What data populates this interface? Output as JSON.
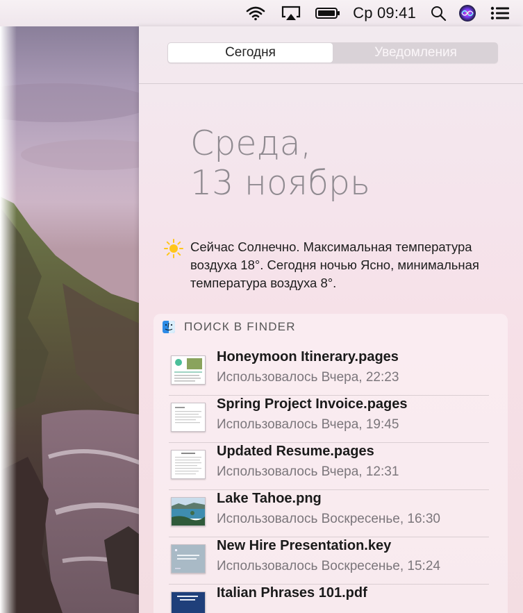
{
  "menubar": {
    "clock": "Ср 09:41",
    "icons": [
      "wifi-icon",
      "airplay-icon",
      "battery-icon",
      "search-icon",
      "siri-icon",
      "notification-center-icon"
    ]
  },
  "notification_center": {
    "tabs": [
      {
        "label": "Сегодня",
        "selected": true
      },
      {
        "label": "Уведомления",
        "selected": false
      }
    ],
    "date": {
      "weekday": "Среда,",
      "day_month": "13 ноябрь"
    },
    "weather": {
      "icon": "sun-icon",
      "summary": "Сейчас Солнечно. Максимальная температура воздуха 18°. Сегодня ночью Ясно, минимальная температура воздуха 8°."
    },
    "finder_widget": {
      "icon": "finder-icon",
      "title": "ПОИСК В FINDER",
      "files": [
        {
          "name": "Honeymoon Itinerary.pages",
          "used": "Использовалось Вчера, 22:23",
          "thumbnail": "pages-doc-thumbnail"
        },
        {
          "name": "Spring Project Invoice.pages",
          "used": "Использовалось Вчера, 19:45",
          "thumbnail": "pages-doc-thumbnail"
        },
        {
          "name": "Updated Resume.pages",
          "used": "Использовалось Вчера, 12:31",
          "thumbnail": "pages-doc-thumbnail"
        },
        {
          "name": "Lake Tahoe.png",
          "used": "Использовалось Воскресенье, 16:30",
          "thumbnail": "image-thumbnail"
        },
        {
          "name": "New Hire Presentation.key",
          "used": "Использовалось Воскресенье, 15:24",
          "thumbnail": "keynote-thumbnail"
        },
        {
          "name": "Italian Phrases 101.pdf",
          "used": "",
          "thumbnail": "pdf-thumbnail"
        }
      ]
    }
  },
  "colors": {
    "panel_bg": "#f5e4ec",
    "segment_selected": "#ffffff",
    "segment_unselected": "#d9d2d7",
    "date_text": "#8f8a90"
  }
}
